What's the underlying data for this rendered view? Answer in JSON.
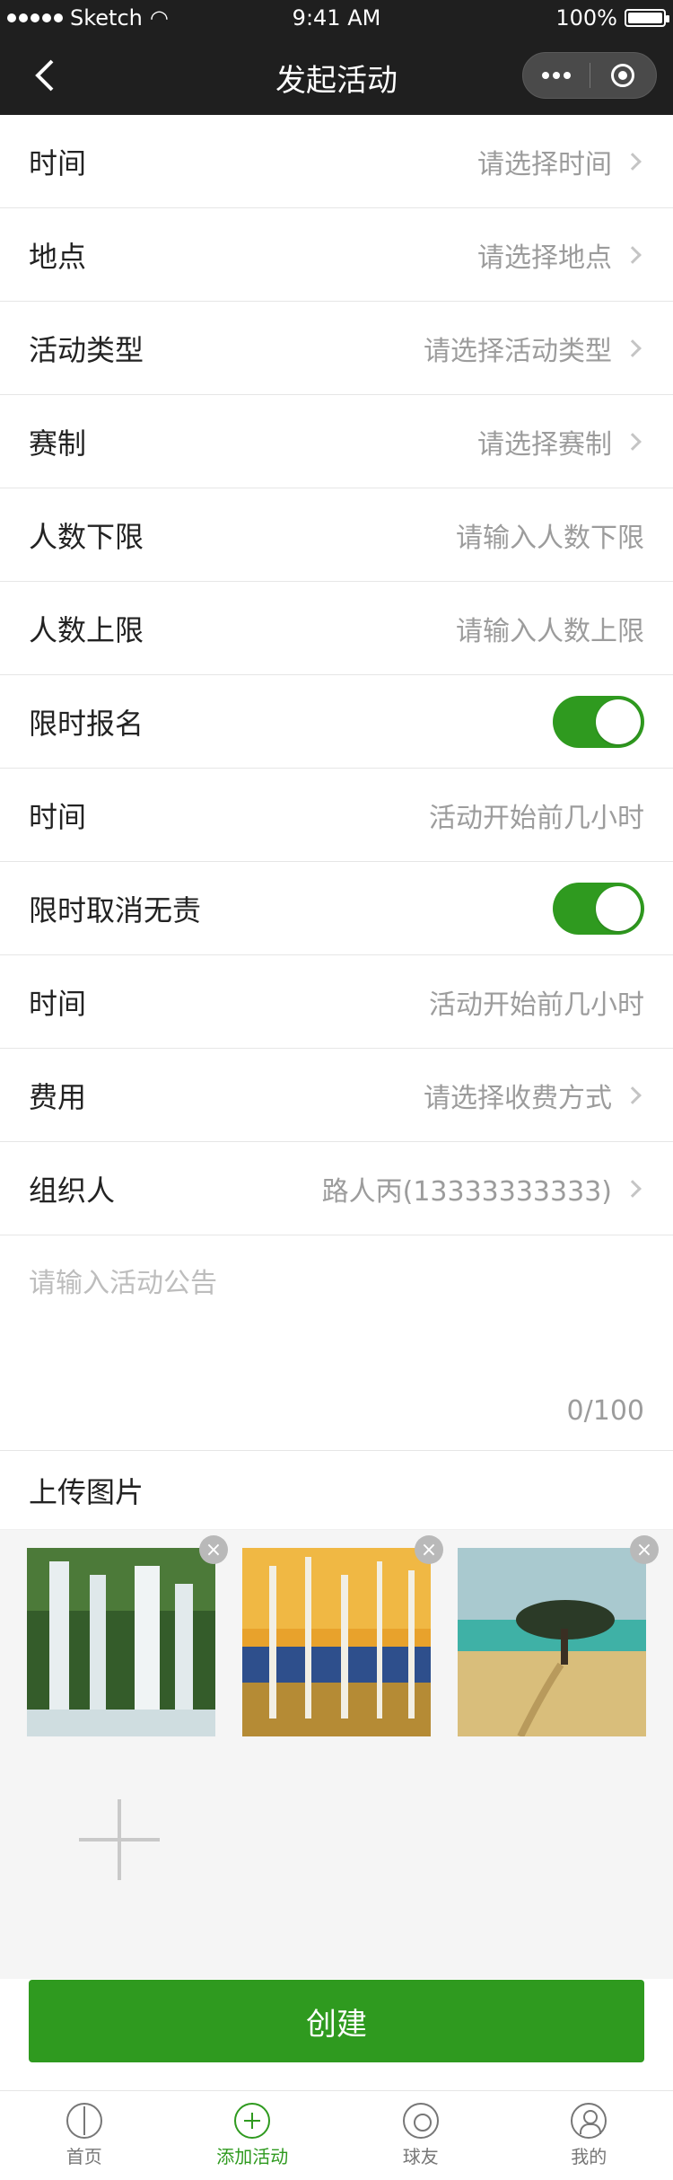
{
  "status": {
    "carrier": "Sketch",
    "time": "9:41 AM",
    "battery": "100%"
  },
  "nav": {
    "title": "发起活动"
  },
  "rows": [
    {
      "label": "时间",
      "value": "请选择时间",
      "type": "select"
    },
    {
      "label": "地点",
      "value": "请选择地点",
      "type": "select"
    },
    {
      "label": "活动类型",
      "value": "请选择活动类型",
      "type": "select"
    },
    {
      "label": "赛制",
      "value": "请选择赛制",
      "type": "select"
    },
    {
      "label": "人数下限",
      "value": "请输入人数下限",
      "type": "input"
    },
    {
      "label": "人数上限",
      "value": "请输入人数上限",
      "type": "input"
    },
    {
      "label": "限时报名",
      "value": "",
      "type": "toggle",
      "on": true
    },
    {
      "label": "时间",
      "value": "活动开始前几小时",
      "type": "input"
    },
    {
      "label": "限时取消无责",
      "value": "",
      "type": "toggle",
      "on": true
    },
    {
      "label": "时间",
      "value": "活动开始前几小时",
      "type": "input"
    },
    {
      "label": "费用",
      "value": "请选择收费方式",
      "type": "select"
    },
    {
      "label": "组织人",
      "value": "路人丙(13333333333)",
      "type": "select"
    }
  ],
  "notice": {
    "placeholder": "请输入活动公告",
    "count": "0/100"
  },
  "upload": {
    "title": "上传图片"
  },
  "create": {
    "label": "创建"
  },
  "tabs": [
    {
      "label": "首页",
      "icon": "basketball-icon"
    },
    {
      "label": "添加活动",
      "icon": "add-circle-icon"
    },
    {
      "label": "球友",
      "icon": "friends-icon"
    },
    {
      "label": "我的",
      "icon": "profile-icon"
    }
  ],
  "colors": {
    "accent": "#2f9a1f",
    "nav": "#1f1f1f"
  }
}
